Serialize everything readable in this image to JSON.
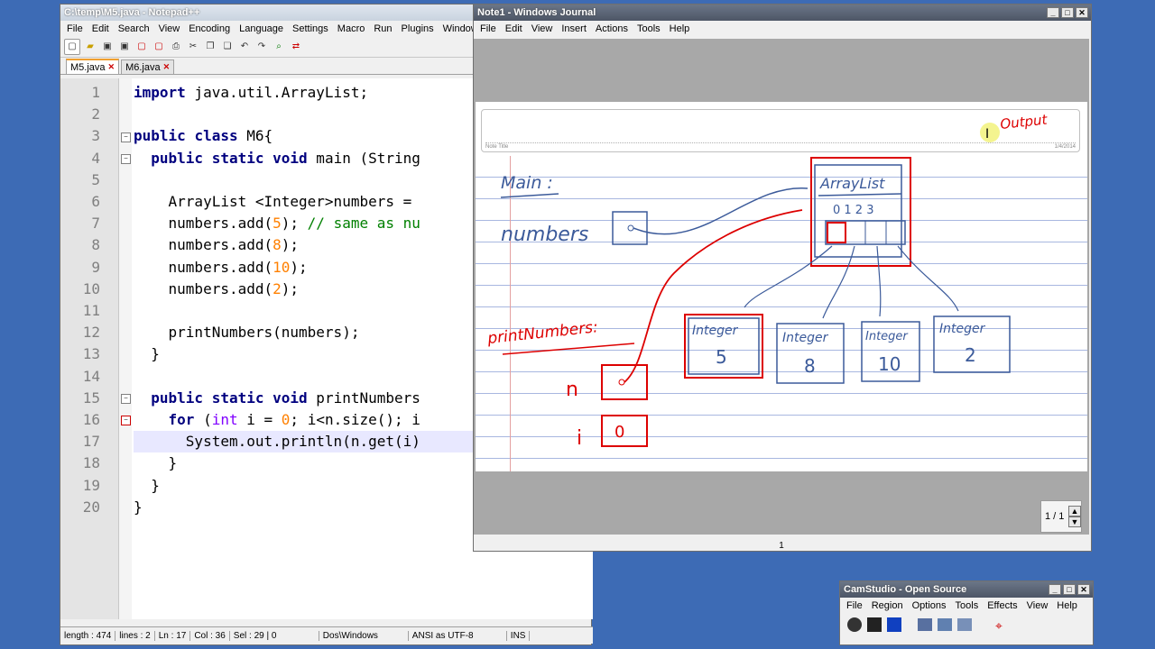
{
  "notepad": {
    "title": "C:\\temp\\M5.java - Notepad++",
    "menu": [
      "File",
      "Edit",
      "Search",
      "View",
      "Encoding",
      "Language",
      "Settings",
      "Macro",
      "Run",
      "Plugins",
      "Window",
      "?"
    ],
    "tabs": [
      {
        "label": "M5.java",
        "active": true
      },
      {
        "label": "M6.java",
        "active": false
      }
    ],
    "lines": [
      {
        "n": "1",
        "html": "<span class=\"kw\">import</span> java.util.ArrayList;"
      },
      {
        "n": "2",
        "html": ""
      },
      {
        "n": "3",
        "html": "<span class=\"kw\">public</span> <span class=\"kw\">class</span> M6{"
      },
      {
        "n": "4",
        "html": "  <span class=\"kw\">public</span> <span class=\"kw\">static</span> <span class=\"kw\">void</span> main (String"
      },
      {
        "n": "5",
        "html": ""
      },
      {
        "n": "6",
        "html": "    ArrayList &lt;Integer&gt;numbers ="
      },
      {
        "n": "7",
        "html": "    numbers.add(<span class=\"num\">5</span>); <span class=\"cm\">// same as nu</span>"
      },
      {
        "n": "8",
        "html": "    numbers.add(<span class=\"num\">8</span>);"
      },
      {
        "n": "9",
        "html": "    numbers.add(<span class=\"num\">10</span>);"
      },
      {
        "n": "10",
        "html": "    numbers.add(<span class=\"num\">2</span>);"
      },
      {
        "n": "11",
        "html": ""
      },
      {
        "n": "12",
        "html": "    printNumbers(numbers);"
      },
      {
        "n": "13",
        "html": "  }"
      },
      {
        "n": "14",
        "html": ""
      },
      {
        "n": "15",
        "html": "  <span class=\"kw\">public</span> <span class=\"kw\">static</span> <span class=\"kw\">void</span> printNumbers"
      },
      {
        "n": "16",
        "html": "    <span class=\"kw\">for</span> (<span class=\"ty\">int</span> i = <span class=\"num\">0</span>; i&lt;n.size(); i"
      },
      {
        "n": "17",
        "html": "      System.out.println(n.get(i)"
      },
      {
        "n": "18",
        "html": "    }"
      },
      {
        "n": "19",
        "html": "  }"
      },
      {
        "n": "20",
        "html": "}"
      }
    ],
    "status": {
      "length": "length : 474",
      "lines": "lines : 2",
      "ln": "Ln : 17",
      "col": "Col : 36",
      "sel": "Sel : 29 | 0",
      "eol": "Dos\\Windows",
      "encoding": "ANSI as UTF-8",
      "mode": "INS"
    }
  },
  "journal": {
    "title": "Note1 - Windows Journal",
    "menu": [
      "File",
      "Edit",
      "View",
      "Insert",
      "Actions",
      "Tools",
      "Help"
    ],
    "page_number": "1",
    "pager": "1 / 1",
    "note_title_label": "Note Title",
    "note_date": "1/4/2014",
    "ink": {
      "output": "Output",
      "main": "Main :",
      "numbers": "numbers",
      "arraylist": "ArrayList",
      "indices": "0  1  2  3",
      "print": "printNumbers:",
      "n": "n",
      "i": "i",
      "i_val": "0",
      "ints": [
        {
          "label": "Integer",
          "value": "5"
        },
        {
          "label": "Integer",
          "value": "8"
        },
        {
          "label": "Integer",
          "value": "10"
        },
        {
          "label": "Integer",
          "value": "2"
        }
      ]
    }
  },
  "camstudio": {
    "title": "CamStudio - Open Source",
    "menu": [
      "File",
      "Region",
      "Options",
      "Tools",
      "Effects",
      "View",
      "Help"
    ]
  }
}
